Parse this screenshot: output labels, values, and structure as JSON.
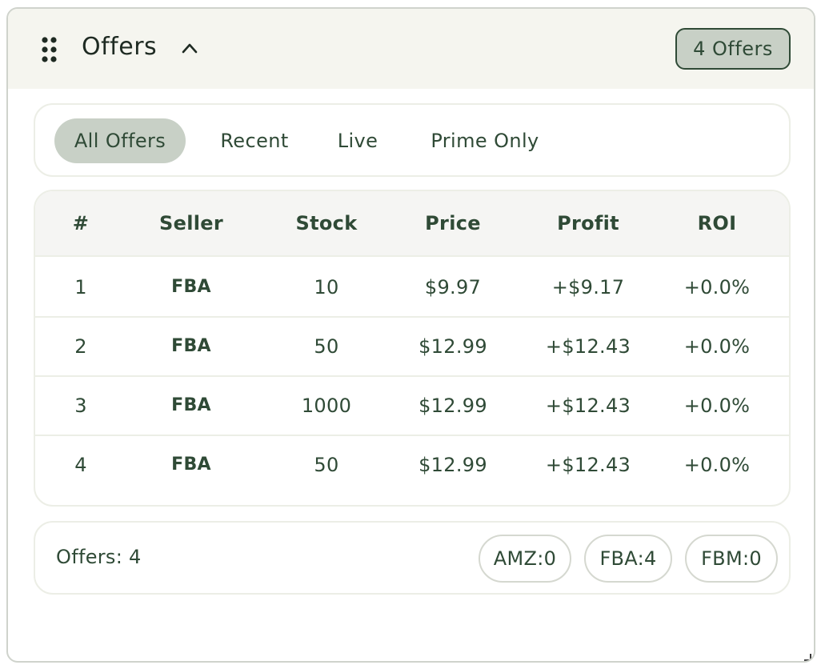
{
  "header": {
    "title": "Offers",
    "badge": "4 Offers"
  },
  "tabs": [
    {
      "label": "All Offers",
      "active": true
    },
    {
      "label": "Recent",
      "active": false
    },
    {
      "label": "Live",
      "active": false
    },
    {
      "label": "Prime Only",
      "active": false
    }
  ],
  "table": {
    "columns": [
      "#",
      "Seller",
      "Stock",
      "Price",
      "Profit",
      "ROI"
    ],
    "rows": [
      [
        "1",
        "FBA",
        "10",
        "$9.97",
        "+$9.17",
        "+0.0%"
      ],
      [
        "2",
        "FBA",
        "50",
        "$12.99",
        "+$12.43",
        "+0.0%"
      ],
      [
        "3",
        "FBA",
        "1000",
        "$12.99",
        "+$12.43",
        "+0.0%"
      ],
      [
        "4",
        "FBA",
        "50",
        "$12.99",
        "+$12.43",
        "+0.0%"
      ]
    ]
  },
  "summary": {
    "offers_label": "Offers: 4",
    "pills": [
      "AMZ:0",
      "FBA:4",
      "FBM:0"
    ]
  },
  "icons": {
    "drag": "drag-handle-icon",
    "collapse": "chevron-up-icon",
    "resize": "resize-grip-icon"
  },
  "colors": {
    "accent": "#2f4a36",
    "header_bg": "#f5f5ef",
    "active_tab_bg": "#c8d0c6",
    "badge_bg": "#c8d0c6"
  }
}
